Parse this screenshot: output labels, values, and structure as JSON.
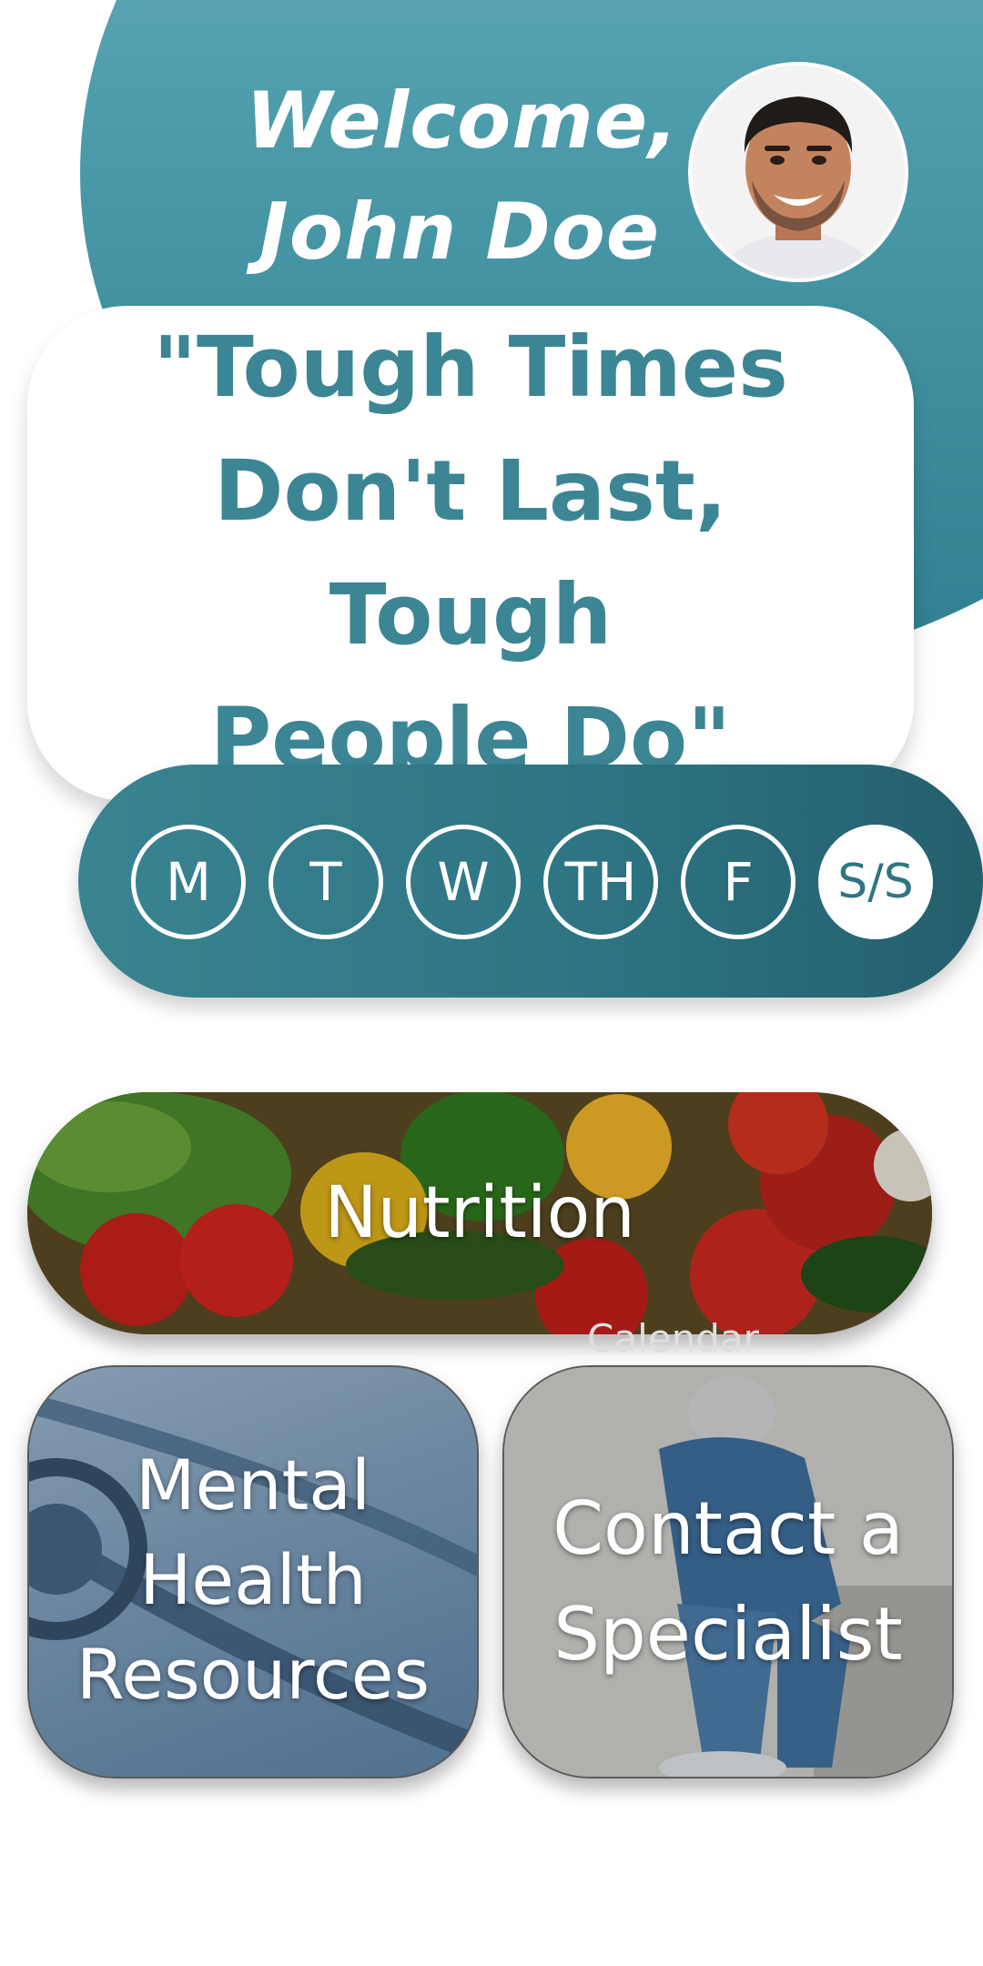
{
  "header": {
    "welcome_line1": "Welcome,",
    "welcome_line2": "John Doe",
    "avatar_icon": "user-avatar-photo"
  },
  "quote": {
    "line1": "\"Tough Times",
    "line2": "Don't Last, Tough",
    "line3": "People Do\""
  },
  "days": [
    {
      "label": "M",
      "active": false
    },
    {
      "label": "T",
      "active": false
    },
    {
      "label": "W",
      "active": false
    },
    {
      "label": "TH",
      "active": false
    },
    {
      "label": "F",
      "active": false
    },
    {
      "label": "S/S",
      "active": true
    }
  ],
  "cards": {
    "nutrition": "Nutrition",
    "calendar_ghost": "Calendar",
    "mental_line1": "Mental",
    "mental_line2": "Health",
    "mental_line3": "Resources",
    "specialist_line1": "Contact a",
    "specialist_line2": "Specialist"
  },
  "colors": {
    "primary": "#3c8594",
    "primary_dark": "#245f6c",
    "white": "#ffffff"
  }
}
